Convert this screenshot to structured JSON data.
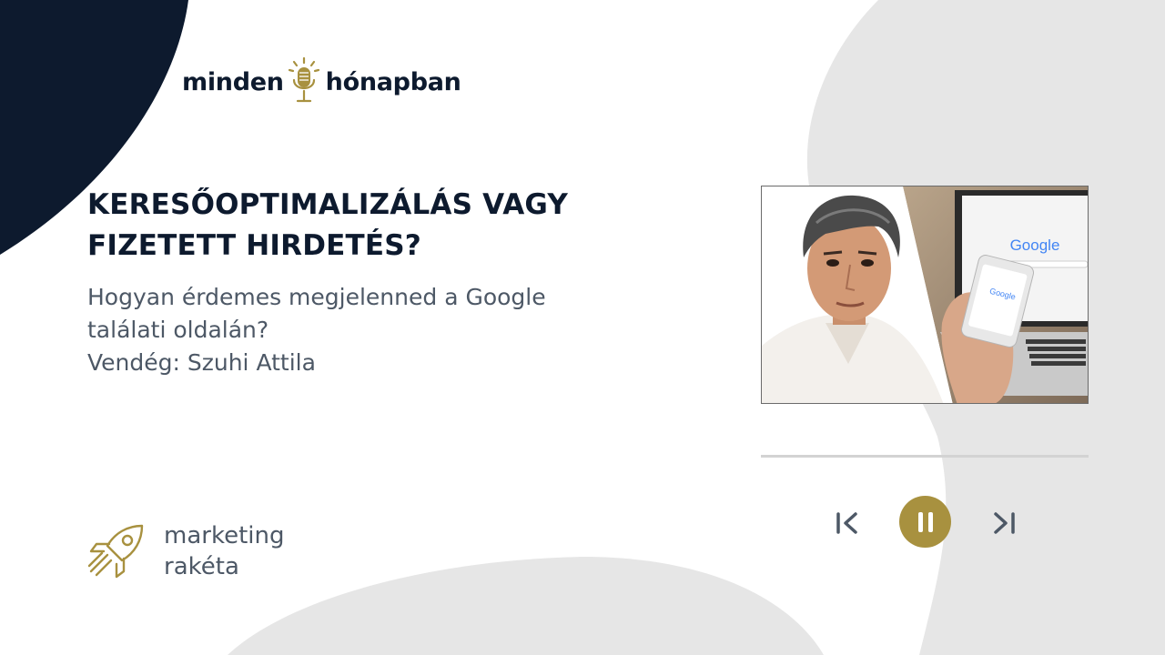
{
  "show": {
    "logo_left": "minden",
    "logo_right": "hónapban",
    "logo_icon": "microphone-icon"
  },
  "episode": {
    "title_line1": "KERESŐOPTIMALIZÁLÁS VAGY",
    "title_line2": "FIZETETT HIRDETÉS?",
    "subtitle_line1": "Hogyan érdemes megjelenned a Google",
    "subtitle_line2": "találati oldalán?",
    "guest_line": "Vendég: Szuhi Attila",
    "photo_text": "Google",
    "photo_phone_text": "Google"
  },
  "player": {
    "progress": 0.0,
    "prev_icon": "skip-previous-icon",
    "pause_icon": "pause-icon",
    "next_icon": "skip-next-icon"
  },
  "brand": {
    "line1": "marketing",
    "line2": "rakéta",
    "icon": "rocket-icon"
  },
  "colors": {
    "navy": "#0d1a2e",
    "gold": "#a8913f",
    "gray_text": "#4d5866",
    "blob_gray": "#e6e6e6"
  }
}
